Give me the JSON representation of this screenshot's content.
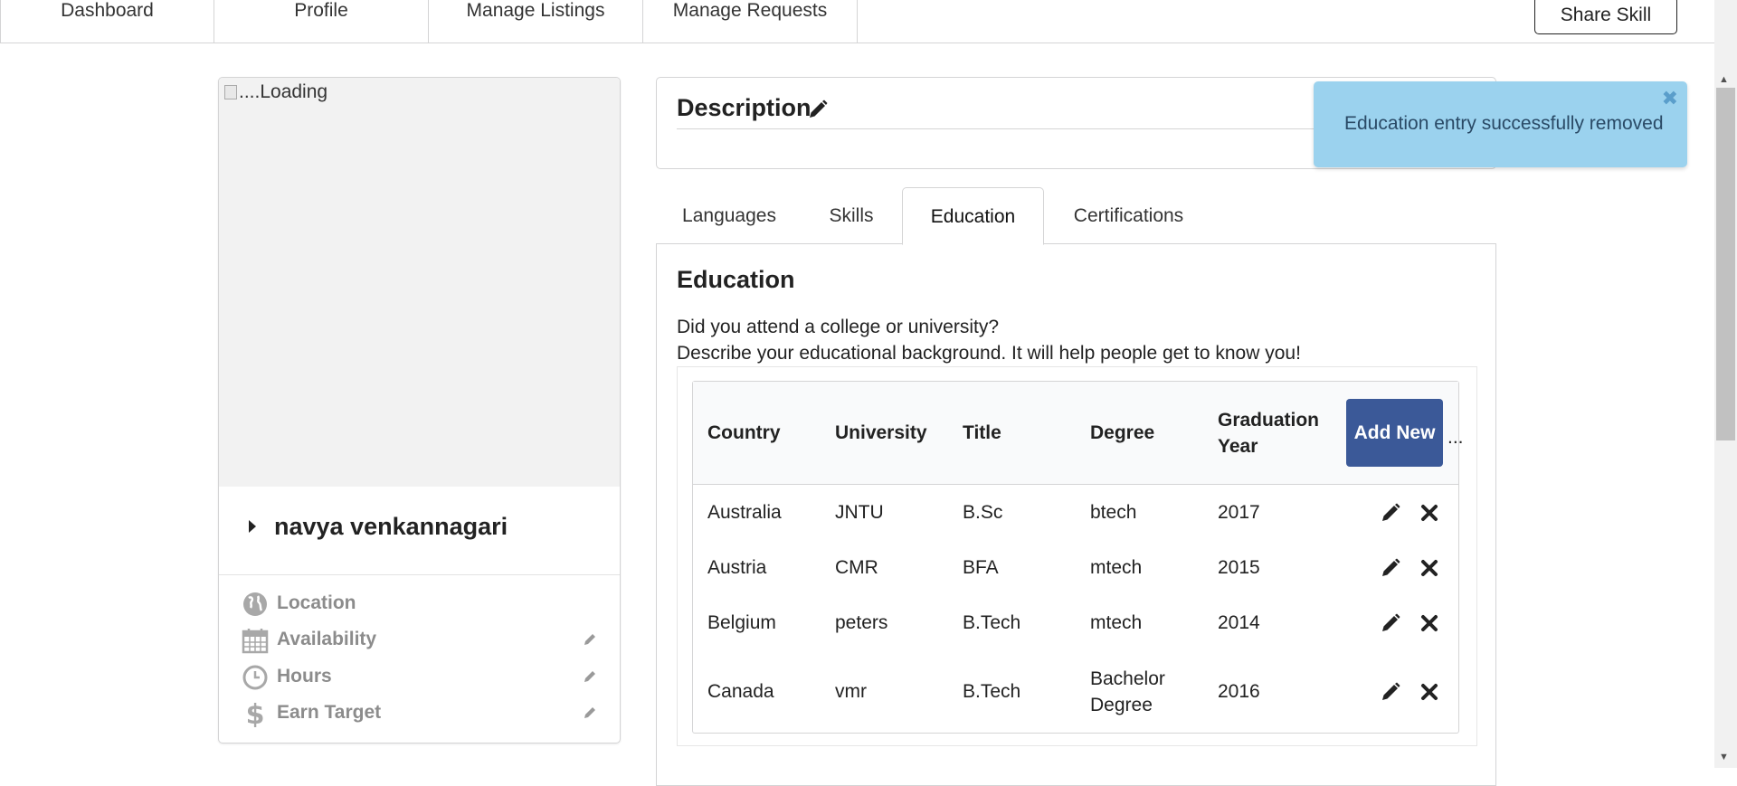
{
  "nav": {
    "items": [
      "Dashboard",
      "Profile",
      "Manage Listings",
      "Manage Requests"
    ],
    "share_label": "Share Skill"
  },
  "profile": {
    "image_alt": "....Loading",
    "name": "navya venkannagari",
    "meta": [
      {
        "label": "Location",
        "icon": "globe-icon",
        "editable": false
      },
      {
        "label": "Availability",
        "icon": "calendar-icon",
        "editable": true
      },
      {
        "label": "Hours",
        "icon": "clock-icon",
        "editable": true
      },
      {
        "label": "Earn Target",
        "icon": "dollar-icon",
        "editable": true
      }
    ]
  },
  "description": {
    "title": "Description"
  },
  "toast": {
    "message": "Education entry successfully removed",
    "color": "#9bd2ee"
  },
  "tabs": [
    {
      "label": "Languages",
      "active": false
    },
    {
      "label": "Skills",
      "active": false
    },
    {
      "label": "Education",
      "active": true
    },
    {
      "label": "Certifications",
      "active": false
    }
  ],
  "education": {
    "heading": "Education",
    "desc_line1": "Did you attend a college or university?",
    "desc_line2": "Describe your educational background. It will help people get to know you!",
    "columns": [
      "Country",
      "University",
      "Title",
      "Degree",
      "Graduation Year"
    ],
    "add_label": "Add New",
    "header_overflow": "...",
    "rows": [
      {
        "country": "Australia",
        "university": "JNTU",
        "title": "B.Sc",
        "degree": "btech",
        "year": "2017"
      },
      {
        "country": "Austria",
        "university": "CMR",
        "title": "BFA",
        "degree": "mtech",
        "year": "2015"
      },
      {
        "country": "Belgium",
        "university": "peters",
        "title": "B.Tech",
        "degree": "mtech",
        "year": "2014"
      },
      {
        "country": "Canada",
        "university": "vmr",
        "title": "B.Tech",
        "degree": "Bachelor Degree",
        "year": "2016"
      }
    ]
  },
  "colors": {
    "primary_button": "#3b5998",
    "border": "#d4d4d5",
    "muted_text": "#8c8c8c"
  }
}
